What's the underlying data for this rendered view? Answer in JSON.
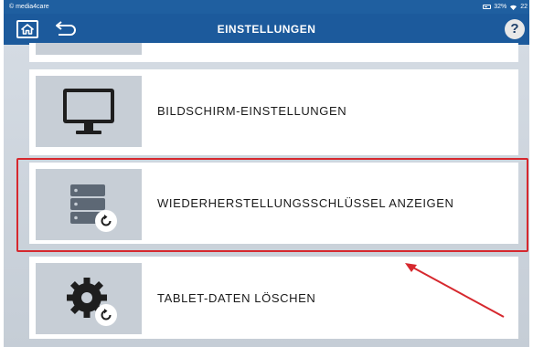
{
  "statusbar": {
    "app": "© media4care",
    "battery": "32%",
    "extra": "22"
  },
  "header": {
    "title": "EINSTELLUNGEN",
    "help_label": "?"
  },
  "colors": {
    "header_bg": "#1c5a9c",
    "highlight": "#d6282e"
  },
  "settings": {
    "items": [
      {
        "label": "",
        "icon": "partial-icon"
      },
      {
        "label": "BILDSCHIRM-EINSTELLUNGEN",
        "icon": "monitor-icon"
      },
      {
        "label": "WIEDERHERSTELLUNGSSCHLÜSSEL ANZEIGEN",
        "icon": "server-restore-icon"
      },
      {
        "label": "TABLET-DATEN LÖSCHEN",
        "icon": "gear-restore-icon"
      }
    ]
  }
}
